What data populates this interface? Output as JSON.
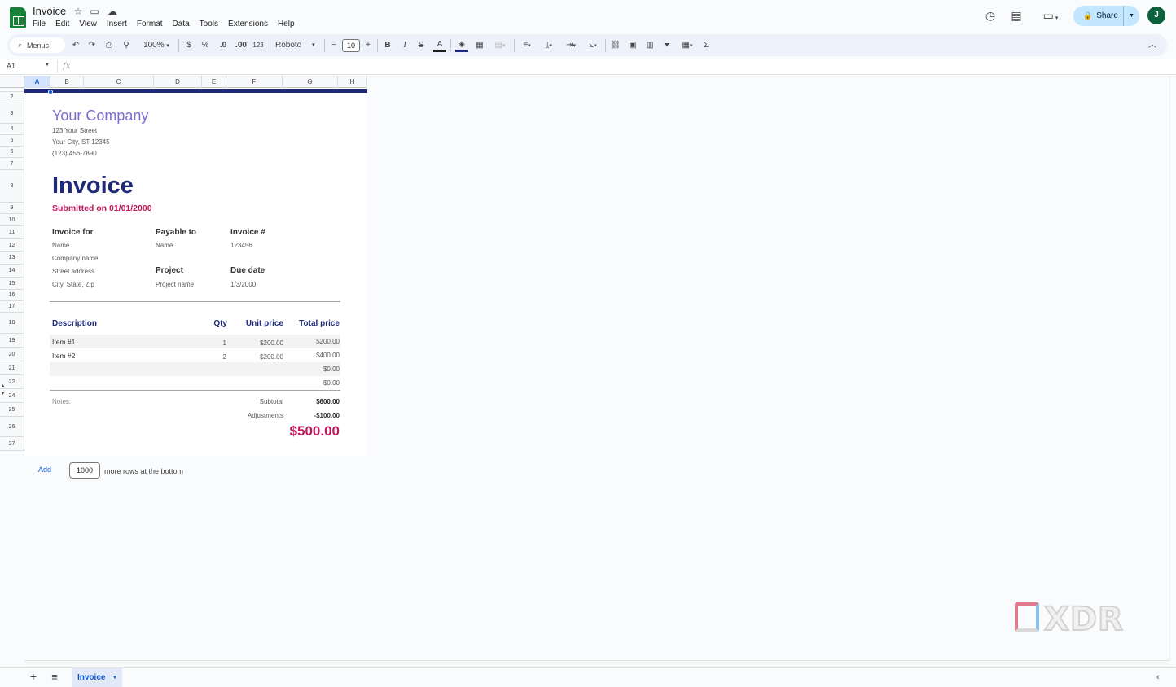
{
  "app": {
    "doc_title": "Invoice",
    "menu": [
      "File",
      "Edit",
      "View",
      "Insert",
      "Format",
      "Data",
      "Tools",
      "Extensions",
      "Help"
    ],
    "share_label": "Share",
    "avatar_initial": "J"
  },
  "toolbar": {
    "menus_label": "Menus",
    "zoom": "100%",
    "currency": "$",
    "percent": "%",
    "dec_decrease": ".0",
    "dec_increase": ".00",
    "number_format": "123",
    "font": "Roboto",
    "font_size": "10",
    "bold": "B",
    "italic": "I",
    "strike": "S",
    "text_color": "A",
    "sum": "Σ"
  },
  "formula_bar": {
    "cell_ref": "A1",
    "fx": "fx"
  },
  "columns": [
    "A",
    "B",
    "C",
    "D",
    "E",
    "F",
    "G",
    "H"
  ],
  "rows": [
    "",
    "2",
    "3",
    "4",
    "5",
    "6",
    "7",
    "8",
    "9",
    "10",
    "11",
    "12",
    "13",
    "14",
    "15",
    "16",
    "17",
    "18",
    "19",
    "20",
    "21",
    "22",
    "24",
    "25",
    "26",
    "27"
  ],
  "invoice": {
    "company": "Your Company",
    "street": "123 Your Street",
    "city": "Your City, ST 12345",
    "phone": "(123) 456-7890",
    "title": "Invoice",
    "submitted": "Submitted on 01/01/2000",
    "invoice_for": {
      "label": "Invoice for",
      "name": "Name",
      "company": "Company name",
      "street": "Street address",
      "city": "City, State, Zip"
    },
    "payable_to": {
      "label": "Payable to",
      "name": "Name"
    },
    "project": {
      "label": "Project",
      "name": "Project name"
    },
    "invoice_no": {
      "label": "Invoice #",
      "value": "123456"
    },
    "due_date": {
      "label": "Due date",
      "value": "1/3/2000"
    },
    "table_headers": {
      "description": "Description",
      "qty": "Qty",
      "unit_price": "Unit price",
      "total_price": "Total price"
    },
    "items": [
      {
        "description": "Item #1",
        "qty": "1",
        "unit_price": "$200.00",
        "total": "$200.00"
      },
      {
        "description": "Item #2",
        "qty": "2",
        "unit_price": "$200.00",
        "total": "$400.00"
      },
      {
        "description": "",
        "qty": "",
        "unit_price": "",
        "total": "$0.00"
      },
      {
        "description": "",
        "qty": "",
        "unit_price": "",
        "total": "$0.00"
      }
    ],
    "notes_label": "Notes:",
    "subtotal_label": "Subtotal",
    "subtotal": "$600.00",
    "adjustments_label": "Adjustments",
    "adjustments": "-$100.00",
    "total": "$500.00"
  },
  "add_rows": {
    "link": "Add",
    "count": "1000",
    "suffix": "more rows at the bottom"
  },
  "sheet_tabs": {
    "active": "Invoice"
  },
  "watermark": "XDR",
  "colors": {
    "accent_navy": "#1e2a78",
    "accent_magenta": "#c2185b",
    "company_purple": "#7b6ccf",
    "share_bg": "#c2e7ff"
  }
}
